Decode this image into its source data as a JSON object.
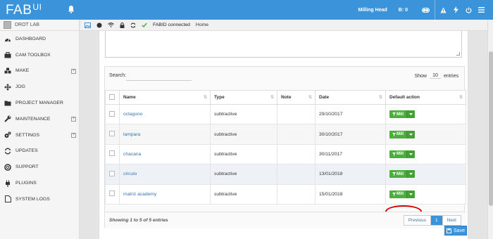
{
  "app": {
    "logo_main": "FAB",
    "logo_sub": "UI"
  },
  "topbar": {
    "head": "Milling Head",
    "b": "B: 0"
  },
  "colors": {
    "accent": "#3b94d9",
    "mill_green": "#4caf3c",
    "link": "#3276b1",
    "highlight_circle": "#d40000"
  },
  "sidebar": {
    "user": "DROT LAB",
    "items": [
      {
        "label": "DASHBOARD",
        "icon": "dashboard-icon"
      },
      {
        "label": "CAM TOOLBOX",
        "icon": "toolbox-icon"
      },
      {
        "label": "MAKE",
        "icon": "cubes-icon",
        "expandable": true
      },
      {
        "label": "JOG",
        "icon": "arrows-icon"
      },
      {
        "label": "PROJECT MANAGER",
        "icon": "folder-icon"
      },
      {
        "label": "MAINTENANCE",
        "icon": "wrench-icon",
        "expandable": true
      },
      {
        "label": "SETTINGS",
        "icon": "cogs-icon",
        "expandable": true
      },
      {
        "label": "UPDATES",
        "icon": "refresh-icon"
      },
      {
        "label": "SUPPORT",
        "icon": "lifebuoy-icon"
      },
      {
        "label": "PLUGINS",
        "icon": "plug-icon"
      },
      {
        "label": "SYSTEM LOGS",
        "icon": "file-icon"
      }
    ]
  },
  "crumb": {
    "connected": "FABID connected",
    "home": "Home"
  },
  "table": {
    "search_label": "Search:",
    "show_label": "Show",
    "show_value": "10",
    "entries_label": "entries",
    "headers": {
      "name": "Name",
      "type": "Type",
      "note": "Note",
      "date": "Date",
      "action": "Default action"
    },
    "rows": [
      {
        "name": "octagono",
        "type": "subtractive",
        "note": "",
        "date": "29/10/2017",
        "action": "Mill"
      },
      {
        "name": "lampara",
        "type": "subtractive",
        "note": "",
        "date": "30/10/2017",
        "action": "Mill"
      },
      {
        "name": "chacana",
        "type": "subtractive",
        "note": "",
        "date": "30/11/2017",
        "action": "Mill"
      },
      {
        "name": "circulo",
        "type": "subtractive",
        "note": "",
        "date": "13/01/2018",
        "action": "Mill"
      },
      {
        "name": "matriz academy",
        "type": "subtractive",
        "note": "",
        "date": "15/01/2018",
        "action": "Mill"
      }
    ],
    "showing": "Showing 1 to 5 of 5 entries",
    "pager": {
      "prev": "Previous",
      "page": "1",
      "next": "Next"
    }
  },
  "save_label": "Save"
}
